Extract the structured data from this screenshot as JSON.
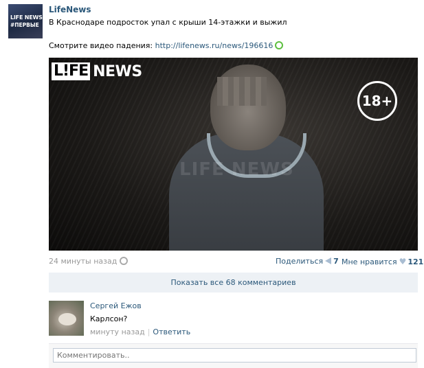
{
  "post": {
    "author": "LifeNews",
    "avatar_logo": "LIFE NEWS",
    "avatar_caption": "#ПЕРВЫЕ",
    "text": "В Краснодаре подросток упал с крыши 14-этажки и выжил",
    "video_prompt": "Смотрите видео падения: ",
    "link": "http://lifenews.ru/news/196616",
    "time": "24 минуты назад"
  },
  "video": {
    "logo_life": "L!FE",
    "logo_news": "NEWS",
    "age_rating": "18+"
  },
  "actions": {
    "share_label": "Поделиться",
    "share_count": "7",
    "like_label": "Мне нравится",
    "like_count": "121"
  },
  "comments": {
    "show_all": "Показать все 68 комментариев",
    "items": [
      {
        "name": "Сергей Ежов",
        "text": "Карлсон?",
        "time": "минуту назад",
        "reply": "Ответить"
      }
    ],
    "placeholder": "Комментировать.."
  },
  "colors": {
    "link": "#2b587a",
    "muted": "#999999",
    "panel": "#edf1f5"
  },
  "icons": {
    "settings": "gear-icon",
    "share": "megaphone-icon",
    "like": "heart-icon",
    "external": "external-link-icon"
  }
}
